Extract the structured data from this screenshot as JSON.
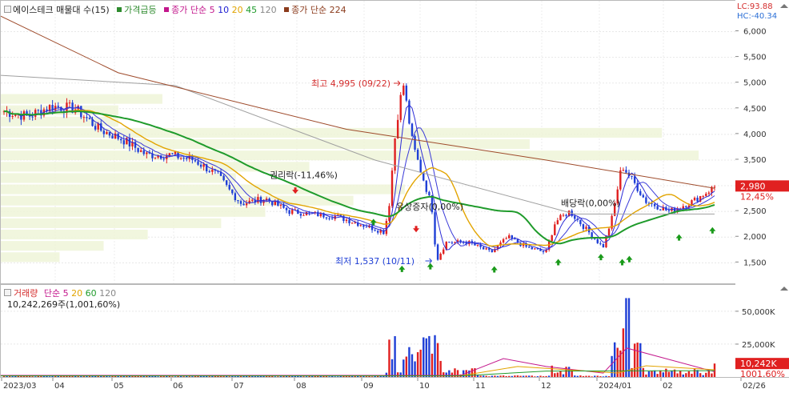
{
  "legend": {
    "stock_name": "에이스테크 매물대 수(15)",
    "price_surge": "가격급등",
    "ma_prefix": "종가 단순",
    "ma_values": [
      "5",
      "10",
      "20",
      "45",
      "120"
    ],
    "ma224": "종가 단순 224",
    "colors": {
      "ma5": "#2b2bd6",
      "ma10": "#1d1dd0",
      "ma20": "#e2a400",
      "ma45": "#1f9b2b",
      "ma120": "#a0a0a0",
      "ma224": "#9e4a2a",
      "surge": "#2e8b2e",
      "ma_prefix": "#c3178c",
      "stock": "#222222",
      "ma224label": "#8b3b1c"
    }
  },
  "corner": {
    "lc": "LC:93.88",
    "hc": "HC:-40.34"
  },
  "price_axis": {
    "ticks": [
      "6,000",
      "5,500",
      "5,000",
      "4,500",
      "4,000",
      "3,500",
      "3,000",
      "2,500",
      "2,000",
      "1,500"
    ],
    "tick_values": [
      6000,
      5500,
      5000,
      4500,
      4000,
      3500,
      3000,
      2500,
      2000,
      1500
    ],
    "current_price": "2,980",
    "current_change": "12,45%"
  },
  "volume_axis": {
    "ticks": [
      "50,000K",
      "25,000K"
    ],
    "tick_values": [
      50000,
      25000
    ],
    "current_volume": "10,242K",
    "current_ratio": "1001,60%"
  },
  "annotations": {
    "high": "최고 4,995 (09/22)",
    "low": "최저 1,537 (10/11)",
    "event1": "권리락(-11,46%)",
    "event2": "유상증자(0,00%)",
    "event3": "배당락(0,00%)"
  },
  "volume_legend": {
    "title": "거래량",
    "ma_prefix": "단순",
    "ma_values": [
      "5",
      "20",
      "60",
      "120"
    ],
    "summary": "10,242,269주(1,001,60%)"
  },
  "x_axis": {
    "labels": [
      "2023/03",
      "04",
      "05",
      "06",
      "07",
      "08",
      "09",
      "10",
      "11",
      "12",
      "2024/01",
      "02",
      "02/26"
    ]
  },
  "chart_data": {
    "type": "candlestick",
    "price_ylim": [
      1100,
      6600
    ],
    "volume_ylim": [
      0,
      70000
    ],
    "month_labels": [
      "2023/03",
      "04",
      "05",
      "06",
      "07",
      "08",
      "09",
      "10",
      "11",
      "12",
      "2024/01",
      "02"
    ],
    "monthly_close_approx": [
      4500,
      4400,
      3800,
      3600,
      2800,
      2500,
      2200,
      2300,
      1900,
      2300,
      2700,
      2700
    ],
    "high": {
      "value": 4995,
      "date": "09/22"
    },
    "low": {
      "value": 1537,
      "date": "10/11"
    },
    "last_close": 2980,
    "last_change_pct": 12.45,
    "last_volume_k": 10242,
    "peak_volume_k": 60000,
    "volume_profile_bins": 15
  }
}
